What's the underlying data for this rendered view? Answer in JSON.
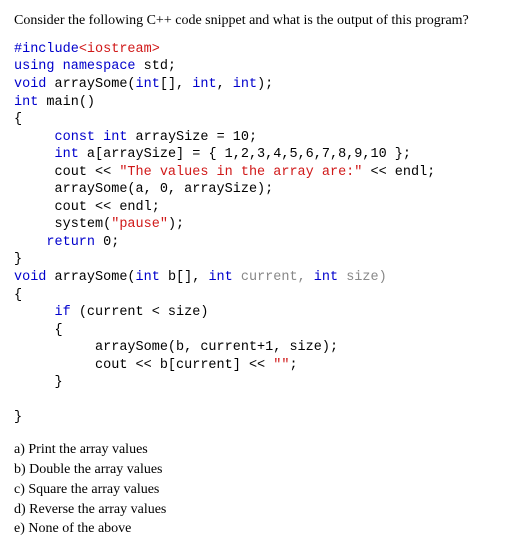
{
  "question": "Consider the following C++ code snippet and what is the output of this program?",
  "code": {
    "l1_inc": "#include",
    "l1_angle": "<iostream>",
    "l2_using": "using",
    "l2_ns": " namespace",
    "l2_std": " std;",
    "l3_void": "void",
    "l3_fn": " arraySome(",
    "l3_int1": "int",
    "l3_arr": "[], ",
    "l3_int2": "int",
    "l3_c1": ", ",
    "l3_int3": "int",
    "l3_end": ");",
    "l4_int": "int",
    "l4_main": " main()",
    "l5": "{",
    "l6_pad": "     ",
    "l6_const": "const",
    "l6_sp1": " ",
    "l6_int": "int",
    "l6_rest": " arraySize = 10;",
    "l7_pad": "     ",
    "l7_int": "int",
    "l7_rest": " a[arraySize] = { 1,2,3,4,5,6,7,8,9,10 };",
    "l8_pad": "     ",
    "l8_cout": "cout << ",
    "l8_str": "\"The values in the array are:\"",
    "l8_end": " << endl;",
    "l9": "     arraySome(a, 0, arraySize);",
    "l10_pad": "     ",
    "l10_rest": "cout << endl;",
    "l11_pad": "     ",
    "l11_sys": "system(",
    "l11_str": "\"pause\"",
    "l11_end": ");",
    "l12_pad": "    ",
    "l12_ret": "return",
    "l12_val": " 0;",
    "l13": "}",
    "l14_void": "void",
    "l14_fn": " arraySome(",
    "l14_int1": "int",
    "l14_b": " b[], ",
    "l14_int2": "int",
    "l14_cur": " current, ",
    "l14_int3": "int",
    "l14_size": " size)",
    "l15": "{",
    "l16_pad": "     ",
    "l16_if": "if",
    "l16_rest": " (current < size)",
    "l17": "     {",
    "l18": "          arraySome(b, current+1, size);",
    "l19_pad": "          ",
    "l19_cout": "cout << b[current] << ",
    "l19_str": "\"\"",
    "l19_end": ";",
    "l20": "     }",
    "l21": "",
    "l22": "}"
  },
  "options": {
    "a": "a) Print the array values",
    "b": "b) Double the array values",
    "c": "c) Square the array values",
    "d": "d) Reverse the array values",
    "e": "e) None of the above"
  }
}
